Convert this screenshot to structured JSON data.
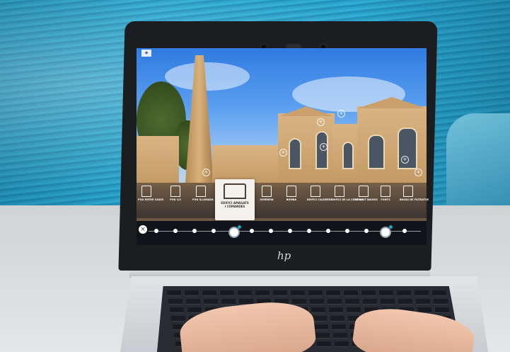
{
  "photo": {
    "subject": "",
    "laptop_brand": "hp"
  },
  "tour_app": {
    "timeline_stops": 14,
    "active_stop": 4,
    "featured_card": {
      "label_line1": "EDIFICI AMAGATS",
      "label_line2": "I COMANDES",
      "sub": ""
    },
    "nav_items": [
      {
        "label": "POU ENTRE CASES",
        "icon": "well-icon"
      },
      {
        "label": "POU 1/2",
        "icon": "well-icon"
      },
      {
        "label": "POU ILLAMADA",
        "icon": "well-icon"
      },
      {
        "label": "EDIFICI AMAGATS",
        "icon": "building-icon"
      },
      {
        "label": "XIMENEIA",
        "icon": "chimney-icon"
      },
      {
        "label": "BOMBA",
        "icon": "pump-icon"
      },
      {
        "label": "EDIFICI CALDERES",
        "icon": "building-icon"
      },
      {
        "label": "EDIFICI DE LA CENTRAL",
        "icon": "building-icon"
      },
      {
        "label": "DIPÒSIT BAIXOS",
        "icon": "tank-icon"
      },
      {
        "label": "FONTS",
        "icon": "fountain-icon"
      },
      {
        "label": "BASSA DE FILTRATGE",
        "icon": "tank-icon"
      }
    ],
    "colors": {
      "accent": "#1aa6b7",
      "timeline_bg": "#101418",
      "card_bg": "#f4f1ec"
    }
  }
}
